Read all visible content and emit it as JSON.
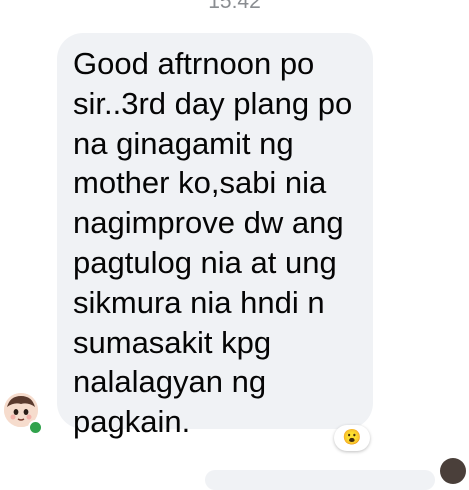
{
  "chat": {
    "timestamp": "15:42",
    "message": {
      "text": "Good aftrnoon po\nsir..3rd day plang po\nna ginagamit ng\nmother ko,sabi nia\nnagimprove dw ang\npagtulog nia at ung\nsikmura nia hndi n\nsumasakit kpg\nnalalagyan ng\npagkain.",
      "reaction": "😮"
    },
    "sender": {
      "avatar_icon": "cartoon-face-avatar",
      "online": true,
      "status_color": "#31a24c"
    }
  },
  "colors": {
    "bubble": "#f0f2f5",
    "text": "#050505",
    "timestamp": "#8a8d91"
  }
}
